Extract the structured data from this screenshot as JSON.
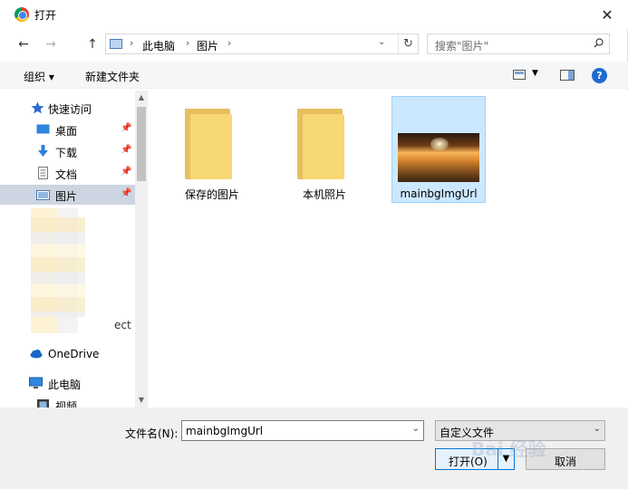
{
  "window": {
    "title": "打开",
    "close_glyph": "✕"
  },
  "address": {
    "back_glyph": "←",
    "forward_glyph": "→",
    "up_glyph": "↑",
    "breadcrumb": [
      "此电脑",
      "图片"
    ],
    "separator": "›",
    "dropdown_glyph": "⌄",
    "refresh_glyph": "↻",
    "search_placeholder": "搜索\"图片\""
  },
  "toolbar": {
    "organize_label": "组织 ▾",
    "new_folder_label": "新建文件夹",
    "help_label": "?"
  },
  "sidebar": {
    "items": [
      {
        "label": "快速访问",
        "icon": "star-icon"
      },
      {
        "label": "桌面",
        "icon": "desktop-icon",
        "pinned": true
      },
      {
        "label": "下载",
        "icon": "download-icon",
        "pinned": true
      },
      {
        "label": "文档",
        "icon": "document-icon",
        "pinned": true
      },
      {
        "label": "图片",
        "icon": "pictures-icon",
        "pinned": true,
        "selected": true
      },
      {
        "label": "OneDrive",
        "icon": "cloud-icon"
      },
      {
        "label": "此电脑",
        "icon": "computer-icon"
      },
      {
        "label": "视频",
        "icon": "video-icon"
      }
    ],
    "truncated_text": "ect",
    "pin_glyph": "📌"
  },
  "files": [
    {
      "name": "保存的图片",
      "type": "folder"
    },
    {
      "name": "本机照片",
      "type": "folder"
    },
    {
      "name": "mainbgImgUrl",
      "type": "image",
      "selected": true
    }
  ],
  "bottom": {
    "filename_label": "文件名(N):",
    "filename_value": "mainbgImgUrl",
    "filetype_value": "自定义文件",
    "open_label": "打开(O)",
    "cancel_label": "取消",
    "watermark": "Bai 经验"
  },
  "colors": {
    "selection": "#cce8ff",
    "nav_selected": "#ccd5e1",
    "accent": "#0078d7"
  }
}
